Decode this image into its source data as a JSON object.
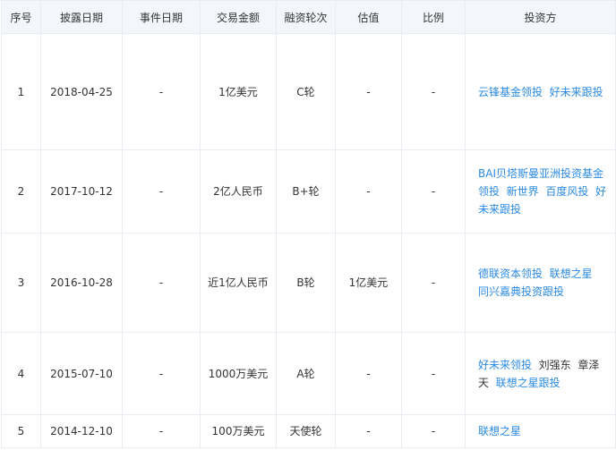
{
  "table": {
    "headers": [
      "序号",
      "披露日期",
      "事件日期",
      "交易金额",
      "融资轮次",
      "估值",
      "比例",
      "投资方"
    ],
    "rows": [
      {
        "cells": [
          "1",
          "2018-04-25",
          "-",
          "1亿美元",
          "C轮",
          "-",
          "-"
        ],
        "investors": [
          {
            "text": "云锋基金领投",
            "link": true
          },
          {
            "text": "好未来跟投",
            "link": true
          }
        ]
      },
      {
        "cells": [
          "2",
          "2017-10-12",
          "-",
          "2亿人民币",
          "B+轮",
          "-",
          "-"
        ],
        "investors": [
          {
            "text": "BAI贝塔斯曼亚洲投资基金领投",
            "link": true
          },
          {
            "text": "新世界",
            "link": true
          },
          {
            "text": "百度风投",
            "link": true
          },
          {
            "text": "好未来跟投",
            "link": true
          }
        ]
      },
      {
        "cells": [
          "3",
          "2016-10-28",
          "-",
          "近1亿人民币",
          "B轮",
          "1亿美元",
          "-"
        ],
        "investors": [
          {
            "text": "德联资本领投",
            "link": true
          },
          {
            "text": "联想之星",
            "link": true
          },
          {
            "text": "同兴嘉典投资跟投",
            "link": true
          }
        ]
      },
      {
        "cells": [
          "4",
          "2015-07-10",
          "-",
          "1000万美元",
          "A轮",
          "-",
          "-"
        ],
        "investors": [
          {
            "text": "好未来领投",
            "link": true
          },
          {
            "text": "刘强东",
            "link": false
          },
          {
            "text": "章泽天",
            "link": false
          },
          {
            "text": "联想之星跟投",
            "link": true
          }
        ]
      },
      {
        "cells": [
          "5",
          "2014-12-10",
          "-",
          "100万美元",
          "天使轮",
          "-",
          "-"
        ],
        "investors": [
          {
            "text": "联想之星",
            "link": true
          }
        ]
      }
    ]
  }
}
